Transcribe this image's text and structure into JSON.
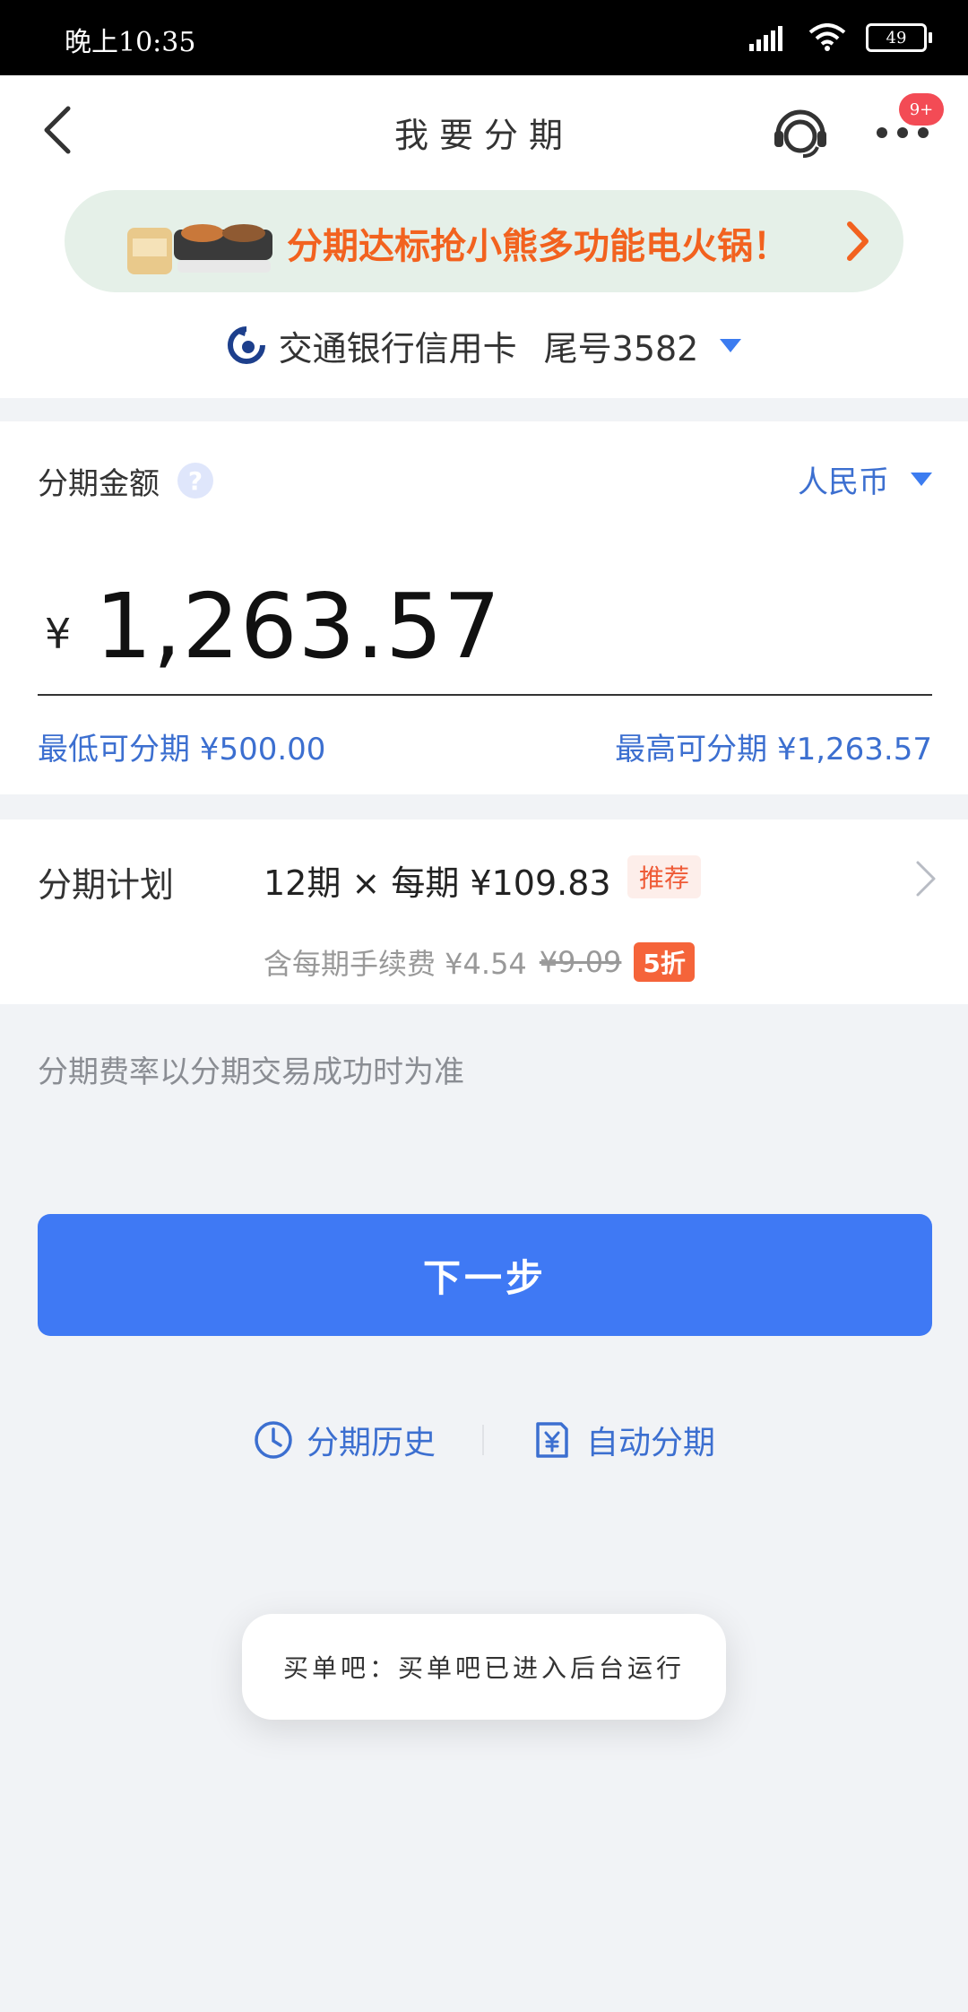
{
  "status_bar": {
    "time": "晚上10:35",
    "battery": "49"
  },
  "header": {
    "title": "我要分期",
    "badge": "9+"
  },
  "banner": {
    "text": "分期达标抢小熊多功能电火锅！"
  },
  "card": {
    "bank_name": "交通银行信用卡",
    "card_suffix": "尾号3582"
  },
  "amount": {
    "label": "分期金额",
    "help": "?",
    "currency": "人民币",
    "yen_sign": "¥",
    "value": "1,263.57",
    "min_text": "最低可分期 ¥500.00",
    "max_text": "最高可分期 ¥1,263.57"
  },
  "plan": {
    "label": "分期计划",
    "main": "12期 × 每期 ¥109.83",
    "tag": "推荐",
    "fee_prefix": "含每期手续费 ¥4.54",
    "fee_old": "¥9.09",
    "discount": "5折"
  },
  "note": "分期费率以分期交易成功时为准",
  "next_button": "下一步",
  "links": {
    "history": "分期历史",
    "auto": "自动分期"
  },
  "toast": "买单吧：买单吧已进入后台运行",
  "colors": {
    "primary": "#3f79f4",
    "link": "#3c6fd0",
    "banner_text": "#f2621f",
    "badge": "#f34b55"
  }
}
